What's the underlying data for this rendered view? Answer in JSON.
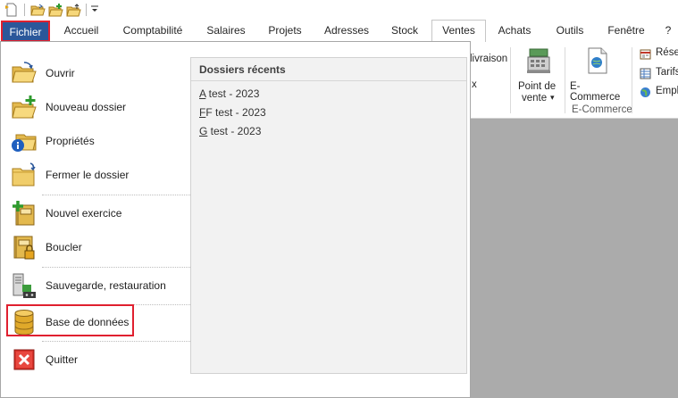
{
  "quick_access": {
    "icons": [
      "new-document-icon",
      "open-folder-icon",
      "new-folder-icon",
      "folder-upload-icon",
      "customize-dropdown-icon"
    ]
  },
  "tabs": [
    {
      "label": "Fichier",
      "state": "file"
    },
    {
      "label": "Accueil"
    },
    {
      "label": "Comptabilité"
    },
    {
      "label": "Salaires"
    },
    {
      "label": "Projets"
    },
    {
      "label": "Adresses"
    },
    {
      "label": "Stock"
    },
    {
      "label": "Ventes",
      "state": "active"
    },
    {
      "label": "Achats"
    },
    {
      "label": "Outils"
    },
    {
      "label": "Fenêtre"
    },
    {
      "label": "?"
    }
  ],
  "ribbon": {
    "livraison_label": "livraison",
    "x_label": "x",
    "pos_label_line1": "Point de",
    "pos_label_line2": "vente",
    "pos_dropdown": "▾",
    "ecommerce_label": "E-Commerce",
    "ecommerce_group": "E-Commerce",
    "right_items": [
      "Rése",
      "Tarifs",
      "Empl"
    ]
  },
  "file_menu": {
    "items": [
      {
        "label": "Ouvrir",
        "icon": "open-folder-icon"
      },
      {
        "label": "Nouveau dossier",
        "icon": "new-folder-icon"
      },
      {
        "label": "Propriétés",
        "icon": "folder-info-icon"
      },
      {
        "label": "Fermer le dossier",
        "icon": "close-folder-icon"
      },
      {
        "label": "Nouvel exercice",
        "icon": "new-fiscal-year-icon"
      },
      {
        "label": "Boucler",
        "icon": "lock-book-icon"
      },
      {
        "label": "Sauvegarde, restauration",
        "icon": "backup-restore-icon"
      },
      {
        "label": "Base de données",
        "icon": "database-icon"
      },
      {
        "label": "Quitter",
        "icon": "exit-icon"
      }
    ],
    "recent": {
      "title": "Dossiers récents",
      "items": [
        {
          "key": "A",
          "rest": " test - 2023"
        },
        {
          "key": "F",
          "rest": "F test - 2023"
        },
        {
          "key": "G",
          "rest": " test - 2023"
        }
      ]
    }
  }
}
